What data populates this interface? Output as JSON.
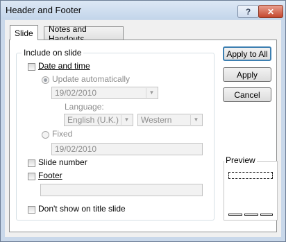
{
  "window": {
    "title": "Header and Footer",
    "help_glyph": "?",
    "close_glyph": "✕"
  },
  "tabs": [
    {
      "label": "Slide"
    },
    {
      "label": "Notes and Handouts"
    }
  ],
  "include": {
    "group_label": "Include on slide",
    "date_time": {
      "label": "Date and time",
      "checked": false
    },
    "update_auto": {
      "label": "Update automatically",
      "selected": true,
      "value": "19/02/2010"
    },
    "language": {
      "label": "Language:",
      "value": "English (U.K.)",
      "calendar": "Western"
    },
    "fixed": {
      "label": "Fixed",
      "selected": false,
      "value": "19/02/2010"
    },
    "slide_number": {
      "label": "Slide number",
      "checked": false
    },
    "footer": {
      "label": "Footer",
      "checked": false,
      "value": ""
    }
  },
  "dont_show": {
    "label": "Don't show on title slide",
    "checked": false
  },
  "buttons": {
    "apply_all": "Apply to All",
    "apply": "Apply",
    "cancel": "Cancel"
  },
  "preview": {
    "label": "Preview"
  },
  "dropdown_glyph": "▼"
}
